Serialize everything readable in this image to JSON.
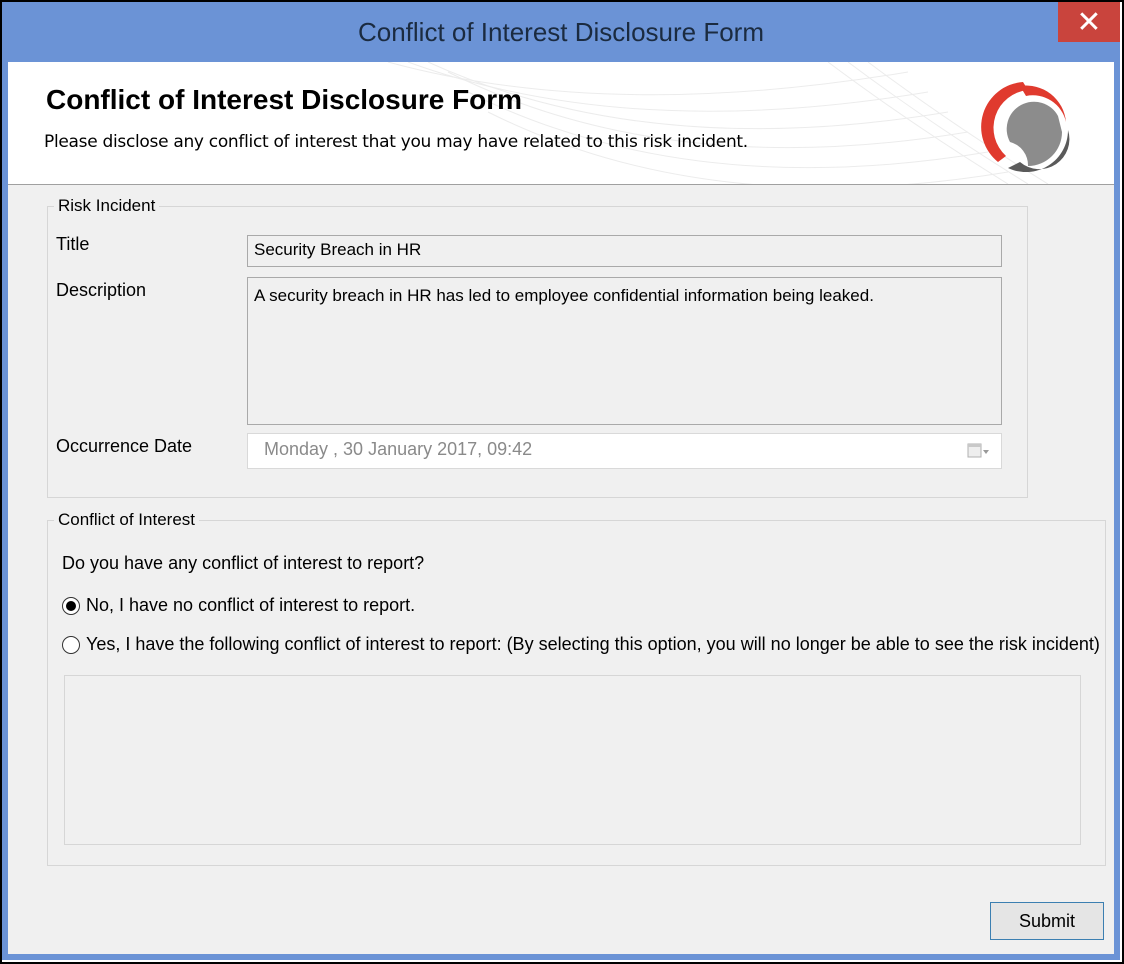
{
  "window": {
    "title": "Conflict of Interest Disclosure Form",
    "close_glyph": "✕"
  },
  "header": {
    "title": "Conflict of Interest Disclosure Form",
    "subtitle": "Please disclose any conflict of interest that you may have related to this risk incident.",
    "logo_icon": "company-logo-icon"
  },
  "risk_incident": {
    "legend": "Risk Incident",
    "title_label": "Title",
    "title_value": "Security Breach in HR",
    "description_label": "Description",
    "description_value": "A security breach in HR has led to employee confidential information being leaked.",
    "date_label": "Occurrence Date",
    "date_value": "Monday   , 30  January   2017, 09:42"
  },
  "conflict": {
    "legend": "Conflict of Interest",
    "question": "Do you have any conflict of interest to report?",
    "option_no": "No, I have no conflict of interest to report.",
    "option_yes": "Yes, I have the following conflict of interest to report: (By selecting this option, you will no longer be able to see the risk incident)",
    "selected": "no",
    "details_value": ""
  },
  "actions": {
    "submit_label": "Submit"
  },
  "colors": {
    "titlebar": "#6b93d6",
    "close": "#c9443d",
    "logo_red": "#e03a2e",
    "logo_gray": "#5a5a5a"
  }
}
